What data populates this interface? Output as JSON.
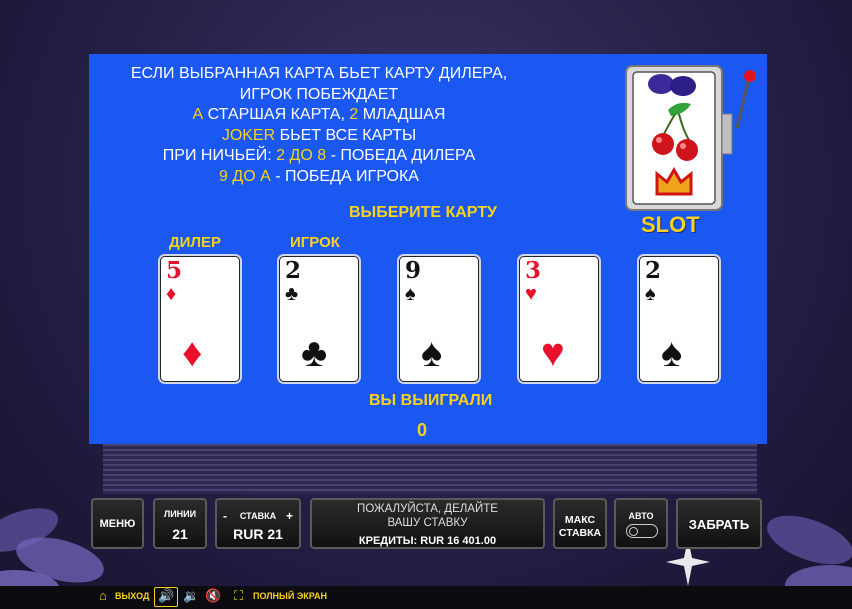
{
  "rules": {
    "line1": "ЕСЛИ ВЫБРАННАЯ КАРТА БЬЕТ КАРТУ ДИЛЕРА,",
    "line2": "ИГРОК ПОБЕЖДАЕТ",
    "line3_a": "А",
    "line3_b": " СТАРШАЯ КАРТА, ",
    "line3_c": "2",
    "line3_d": " МЛАДШАЯ",
    "line4_a": "JOKER",
    "line4_b": " БЬЕТ ВСЕ КАРТЫ",
    "line5_a": "ПРИ НИЧЬЕЙ: ",
    "line5_b": "2 ДО 8",
    "line5_c": " - ПОБЕДА ДИЛЕРА",
    "line6_a": "9 ДО А",
    "line6_b": " - ПОБЕДА ИГРОКА"
  },
  "choose_label": "ВЫБЕРИТЕ КАРТУ",
  "dealer_label": "ДИЛЕР",
  "player_label": "ИГРОК",
  "cards": [
    {
      "rank": "5",
      "suit": "♦",
      "color": "red"
    },
    {
      "rank": "2",
      "suit": "♣",
      "color": "black"
    },
    {
      "rank": "9",
      "suit": "♠",
      "color": "black"
    },
    {
      "rank": "3",
      "suit": "♥",
      "color": "red"
    },
    {
      "rank": "2",
      "suit": "♠",
      "color": "black"
    }
  ],
  "win_label": "ВЫ ВЫИГРАЛИ",
  "win_value": "0",
  "slot_logo": "SLOT",
  "controls": {
    "menu": "МЕНЮ",
    "lines_title": "ЛИНИИ",
    "lines_value": "21",
    "stake_title": "СТАВКА",
    "stake_minus": "-",
    "stake_plus": "+",
    "stake_value": "RUR 21",
    "message_line1": "ПОЖАЛУЙСТА, ДЕЛАЙТЕ",
    "message_line2": "ВАШУ СТАВКУ",
    "credits": "КРЕДИТЫ:  RUR 16 401.00",
    "max_line1": "МАКС",
    "max_line2": "СТАВКА",
    "auto": "АВТО",
    "collect": "ЗАБРАТЬ"
  },
  "footer": {
    "exit": "ВЫХОД",
    "fullscreen": "ПОЛНЫЙ ЭКРАН",
    "icons": [
      "home-icon",
      "sound-settings-icon",
      "volume-icon",
      "mute-icon",
      "fullscreen-icon"
    ]
  },
  "colors": {
    "panel": "#1b58f2",
    "highlight": "#f7d21c",
    "red_suit": "#e8102a"
  }
}
